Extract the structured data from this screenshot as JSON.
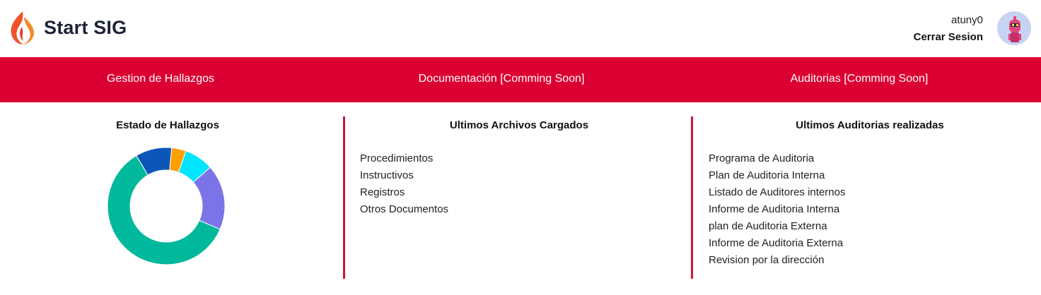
{
  "header": {
    "logo_text": "Start SIG",
    "username": "atuny0",
    "logout_label": "Cerrar Sesion"
  },
  "nav": {
    "items": [
      {
        "label": "Gestion de Hallazgos"
      },
      {
        "label": "Documentación [Comming Soon]"
      },
      {
        "label": "Auditorias [Comming Soon]"
      }
    ]
  },
  "panels": {
    "hallazgos": {
      "title": "Estado de Hallazgos",
      "chart_data": {
        "type": "pie",
        "donut": true,
        "values": [
          60,
          10,
          4,
          8,
          18
        ],
        "colors": [
          "#00b89c",
          "#0b56b8",
          "#ffa000",
          "#00e5ff",
          "#7b74e8"
        ]
      }
    },
    "archivos": {
      "title": "Ultimos Archivos Cargados",
      "items": [
        "Procedimientos",
        "Instructivos",
        "Registros",
        "Otros Documentos"
      ]
    },
    "auditorias": {
      "title": "Ultimos Auditorias realizadas",
      "items": [
        "Programa de Auditoria",
        "Plan de Auditoria Interna",
        "Listado de Auditores internos",
        "Informe de Auditoria Interna",
        "plan de Auditoria Externa",
        "Informe de Auditoria Externa",
        "Revision por la dirección"
      ]
    }
  },
  "colors": {
    "brand_red": "#dc0032",
    "divider_red": "#d3133d",
    "logo_dark": "#1c2238"
  }
}
